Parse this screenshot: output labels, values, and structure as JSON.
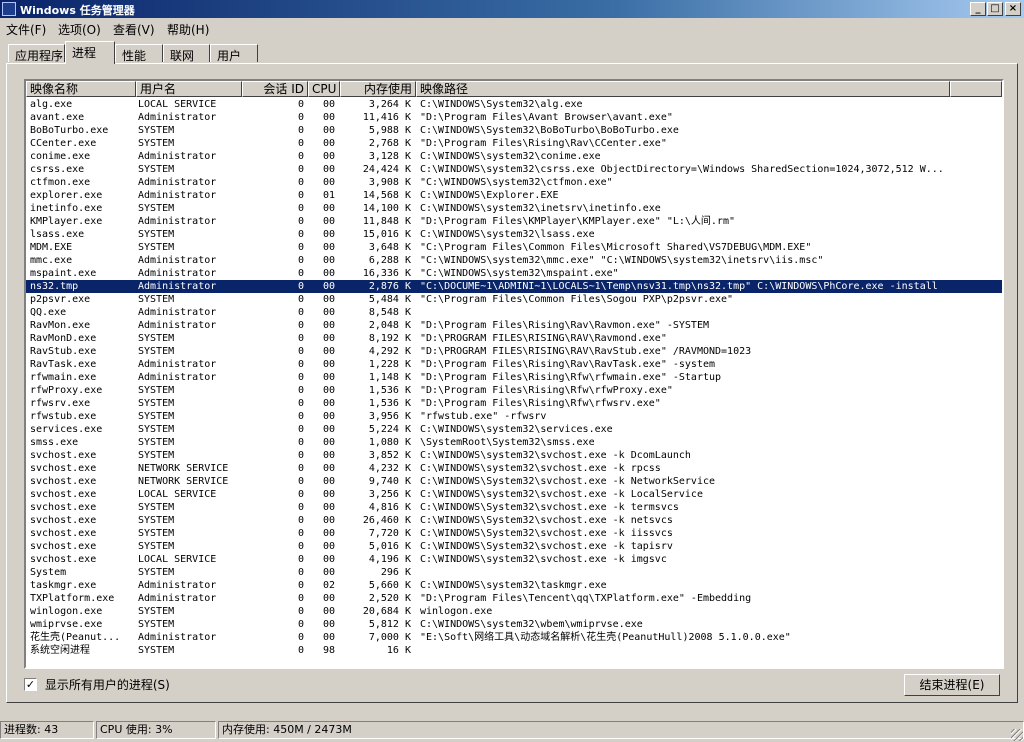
{
  "window": {
    "title": "Windows 任务管理器",
    "buttons": [
      "_",
      "□",
      "×"
    ]
  },
  "menu": [
    "文件(F)",
    "选项(O)",
    "查看(V)",
    "帮助(H)"
  ],
  "tabs": [
    "应用程序",
    "进程",
    "性能",
    "联网",
    "用户"
  ],
  "columns": [
    "映像名称",
    "用户名",
    "会话 ID",
    "CPU",
    "内存使用",
    "映像路径"
  ],
  "processes": [
    {
      "n": "alg.exe",
      "u": "LOCAL SERVICE",
      "s": "0",
      "c": "00",
      "m": "3,264 K",
      "p": "C:\\WINDOWS\\System32\\alg.exe"
    },
    {
      "n": "avant.exe",
      "u": "Administrator",
      "s": "0",
      "c": "00",
      "m": "11,416 K",
      "p": "\"D:\\Program Files\\Avant Browser\\avant.exe\""
    },
    {
      "n": "BoBoTurbo.exe",
      "u": "SYSTEM",
      "s": "0",
      "c": "00",
      "m": "5,988 K",
      "p": "C:\\WINDOWS\\System32\\BoBoTurbo\\BoBoTurbo.exe"
    },
    {
      "n": "CCenter.exe",
      "u": "SYSTEM",
      "s": "0",
      "c": "00",
      "m": "2,768 K",
      "p": "\"D:\\Program Files\\Rising\\Rav\\CCenter.exe\""
    },
    {
      "n": "conime.exe",
      "u": "Administrator",
      "s": "0",
      "c": "00",
      "m": "3,128 K",
      "p": "C:\\WINDOWS\\system32\\conime.exe"
    },
    {
      "n": "csrss.exe",
      "u": "SYSTEM",
      "s": "0",
      "c": "00",
      "m": "24,424 K",
      "p": "C:\\WINDOWS\\system32\\csrss.exe ObjectDirectory=\\Windows SharedSection=1024,3072,512 W..."
    },
    {
      "n": "ctfmon.exe",
      "u": "Administrator",
      "s": "0",
      "c": "00",
      "m": "3,908 K",
      "p": "\"C:\\WINDOWS\\system32\\ctfmon.exe\""
    },
    {
      "n": "explorer.exe",
      "u": "Administrator",
      "s": "0",
      "c": "01",
      "m": "14,568 K",
      "p": "C:\\WINDOWS\\Explorer.EXE"
    },
    {
      "n": "inetinfo.exe",
      "u": "SYSTEM",
      "s": "0",
      "c": "00",
      "m": "14,100 K",
      "p": "C:\\WINDOWS\\system32\\inetsrv\\inetinfo.exe"
    },
    {
      "n": "KMPlayer.exe",
      "u": "Administrator",
      "s": "0",
      "c": "00",
      "m": "11,848 K",
      "p": "\"D:\\Program Files\\KMPlayer\\KMPlayer.exe\"  \"L:\\人间.rm\""
    },
    {
      "n": "lsass.exe",
      "u": "SYSTEM",
      "s": "0",
      "c": "00",
      "m": "15,016 K",
      "p": "C:\\WINDOWS\\system32\\lsass.exe"
    },
    {
      "n": "MDM.EXE",
      "u": "SYSTEM",
      "s": "0",
      "c": "00",
      "m": "3,648 K",
      "p": "\"C:\\Program Files\\Common Files\\Microsoft Shared\\VS7DEBUG\\MDM.EXE\""
    },
    {
      "n": "mmc.exe",
      "u": "Administrator",
      "s": "0",
      "c": "00",
      "m": "6,288 K",
      "p": "\"C:\\WINDOWS\\system32\\mmc.exe\" \"C:\\WINDOWS\\system32\\inetsrv\\iis.msc\""
    },
    {
      "n": "mspaint.exe",
      "u": "Administrator",
      "s": "0",
      "c": "00",
      "m": "16,336 K",
      "p": "\"C:\\WINDOWS\\system32\\mspaint.exe\""
    },
    {
      "n": "ns32.tmp",
      "u": "Administrator",
      "s": "0",
      "c": "00",
      "m": "2,876 K",
      "p": "\"C:\\DOCUME~1\\ADMINI~1\\LOCALS~1\\Temp\\nsv31.tmp\\ns32.tmp\" C:\\WINDOWS\\PhCore.exe -install",
      "selected": true
    },
    {
      "n": "p2psvr.exe",
      "u": "SYSTEM",
      "s": "0",
      "c": "00",
      "m": "5,484 K",
      "p": "\"C:\\Program Files\\Common Files\\Sogou PXP\\p2psvr.exe\""
    },
    {
      "n": "QQ.exe",
      "u": "Administrator",
      "s": "0",
      "c": "00",
      "m": "8,548 K",
      "p": ""
    },
    {
      "n": "RavMon.exe",
      "u": "Administrator",
      "s": "0",
      "c": "00",
      "m": "2,048 K",
      "p": "\"D:\\Program Files\\Rising\\Rav\\Ravmon.exe\" -SYSTEM"
    },
    {
      "n": "RavMonD.exe",
      "u": "SYSTEM",
      "s": "0",
      "c": "00",
      "m": "8,192 K",
      "p": "\"D:\\PROGRAM FILES\\RISING\\RAV\\Ravmond.exe\""
    },
    {
      "n": "RavStub.exe",
      "u": "SYSTEM",
      "s": "0",
      "c": "00",
      "m": "4,292 K",
      "p": "\"D:\\PROGRAM FILES\\RISING\\RAV\\RavStub.exe\" /RAVMOND=1023"
    },
    {
      "n": "RavTask.exe",
      "u": "Administrator",
      "s": "0",
      "c": "00",
      "m": "1,228 K",
      "p": "\"D:\\Program Files\\Rising\\Rav\\RavTask.exe\"  -system"
    },
    {
      "n": "rfwmain.exe",
      "u": "Administrator",
      "s": "0",
      "c": "00",
      "m": "1,148 K",
      "p": "\"D:\\Program Files\\Rising\\Rfw\\rfwmain.exe\"  -Startup"
    },
    {
      "n": "rfwProxy.exe",
      "u": "SYSTEM",
      "s": "0",
      "c": "00",
      "m": "1,536 K",
      "p": "\"D:\\Program Files\\Rising\\Rfw\\rfwProxy.exe\""
    },
    {
      "n": "rfwsrv.exe",
      "u": "SYSTEM",
      "s": "0",
      "c": "00",
      "m": "1,536 K",
      "p": "\"D:\\Program Files\\Rising\\Rfw\\rfwsrv.exe\""
    },
    {
      "n": "rfwstub.exe",
      "u": "SYSTEM",
      "s": "0",
      "c": "00",
      "m": "3,956 K",
      "p": "\"rfwstub.exe\" -rfwsrv"
    },
    {
      "n": "services.exe",
      "u": "SYSTEM",
      "s": "0",
      "c": "00",
      "m": "5,224 K",
      "p": "C:\\WINDOWS\\system32\\services.exe"
    },
    {
      "n": "smss.exe",
      "u": "SYSTEM",
      "s": "0",
      "c": "00",
      "m": "1,080 K",
      "p": "\\SystemRoot\\System32\\smss.exe"
    },
    {
      "n": "svchost.exe",
      "u": "SYSTEM",
      "s": "0",
      "c": "00",
      "m": "3,852 K",
      "p": "C:\\WINDOWS\\system32\\svchost.exe -k DcomLaunch"
    },
    {
      "n": "svchost.exe",
      "u": "NETWORK SERVICE",
      "s": "0",
      "c": "00",
      "m": "4,232 K",
      "p": "C:\\WINDOWS\\system32\\svchost.exe -k rpcss"
    },
    {
      "n": "svchost.exe",
      "u": "NETWORK SERVICE",
      "s": "0",
      "c": "00",
      "m": "9,740 K",
      "p": "C:\\WINDOWS\\System32\\svchost.exe -k NetworkService"
    },
    {
      "n": "svchost.exe",
      "u": "LOCAL SERVICE",
      "s": "0",
      "c": "00",
      "m": "3,256 K",
      "p": "C:\\WINDOWS\\system32\\svchost.exe -k LocalService"
    },
    {
      "n": "svchost.exe",
      "u": "SYSTEM",
      "s": "0",
      "c": "00",
      "m": "4,816 K",
      "p": "C:\\WINDOWS\\System32\\svchost.exe -k termsvcs"
    },
    {
      "n": "svchost.exe",
      "u": "SYSTEM",
      "s": "0",
      "c": "00",
      "m": "26,460 K",
      "p": "C:\\WINDOWS\\System32\\svchost.exe -k netsvcs"
    },
    {
      "n": "svchost.exe",
      "u": "SYSTEM",
      "s": "0",
      "c": "00",
      "m": "7,720 K",
      "p": "C:\\WINDOWS\\System32\\svchost.exe -k iissvcs"
    },
    {
      "n": "svchost.exe",
      "u": "SYSTEM",
      "s": "0",
      "c": "00",
      "m": "5,016 K",
      "p": "C:\\WINDOWS\\System32\\svchost.exe -k tapisrv"
    },
    {
      "n": "svchost.exe",
      "u": "LOCAL SERVICE",
      "s": "0",
      "c": "00",
      "m": "4,196 K",
      "p": "C:\\WINDOWS\\system32\\svchost.exe -k imgsvc"
    },
    {
      "n": "System",
      "u": "SYSTEM",
      "s": "0",
      "c": "00",
      "m": "296 K",
      "p": ""
    },
    {
      "n": "taskmgr.exe",
      "u": "Administrator",
      "s": "0",
      "c": "02",
      "m": "5,660 K",
      "p": "C:\\WINDOWS\\system32\\taskmgr.exe"
    },
    {
      "n": "TXPlatform.exe",
      "u": "Administrator",
      "s": "0",
      "c": "00",
      "m": "2,520 K",
      "p": "\"D:\\Program Files\\Tencent\\qq\\TXPlatform.exe\" -Embedding"
    },
    {
      "n": "winlogon.exe",
      "u": "SYSTEM",
      "s": "0",
      "c": "00",
      "m": "20,684 K",
      "p": "winlogon.exe"
    },
    {
      "n": "wmiprvse.exe",
      "u": "SYSTEM",
      "s": "0",
      "c": "00",
      "m": "5,812 K",
      "p": "C:\\WINDOWS\\system32\\wbem\\wmiprvse.exe"
    },
    {
      "n": "花生壳(Peanut...",
      "u": "Administrator",
      "s": "0",
      "c": "00",
      "m": "7,000 K",
      "p": "\"E:\\Soft\\网络工具\\动态域名解析\\花生壳(PeanutHull)2008 5.1.0.0.exe\""
    },
    {
      "n": "系统空闲进程",
      "u": "SYSTEM",
      "s": "0",
      "c": "98",
      "m": "16 K",
      "p": ""
    }
  ],
  "show_all_users": {
    "label": "显示所有用户的进程(S)",
    "checked": "✓"
  },
  "end_process_label": "结束进程(E)",
  "status": {
    "process_count": "进程数: 43",
    "cpu_usage": "CPU 使用: 3%",
    "memory_usage": "内存使用: 450M / 2473M"
  }
}
